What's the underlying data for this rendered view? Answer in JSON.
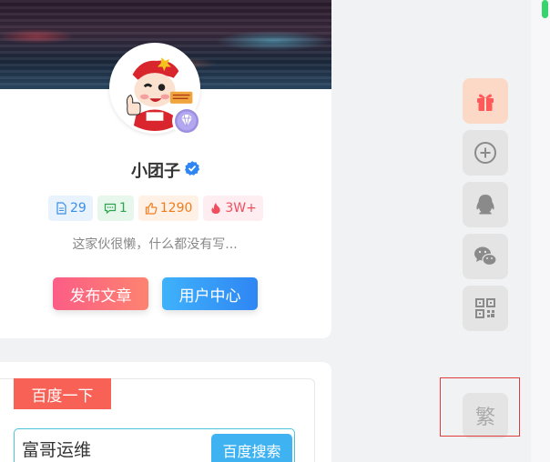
{
  "profile": {
    "username": "小团子",
    "stats": {
      "posts": "29",
      "comments": "1",
      "likes": "1290",
      "hot": "3W+"
    },
    "bio": "这家伙很懒，什么都没有写...",
    "publish_label": "发布文章",
    "user_center_label": "用户中心"
  },
  "search": {
    "tab_label": "百度一下",
    "input_value": "富哥运维",
    "button_label": "百度搜索"
  },
  "float_toolbar": {
    "items": [
      "gift-icon",
      "add-circle-icon",
      "qq-icon",
      "wechat-icon",
      "qrcode-icon"
    ],
    "traditional_label": "繁"
  },
  "colors": {
    "publish_gradient": [
      "#fc5d86",
      "#fd8370"
    ],
    "user_center_gradient": [
      "#3fb2fb",
      "#2f86f3"
    ],
    "search_tab": "#f86156",
    "search_button": "#3fb3f2",
    "verified": "#2f86f3"
  }
}
